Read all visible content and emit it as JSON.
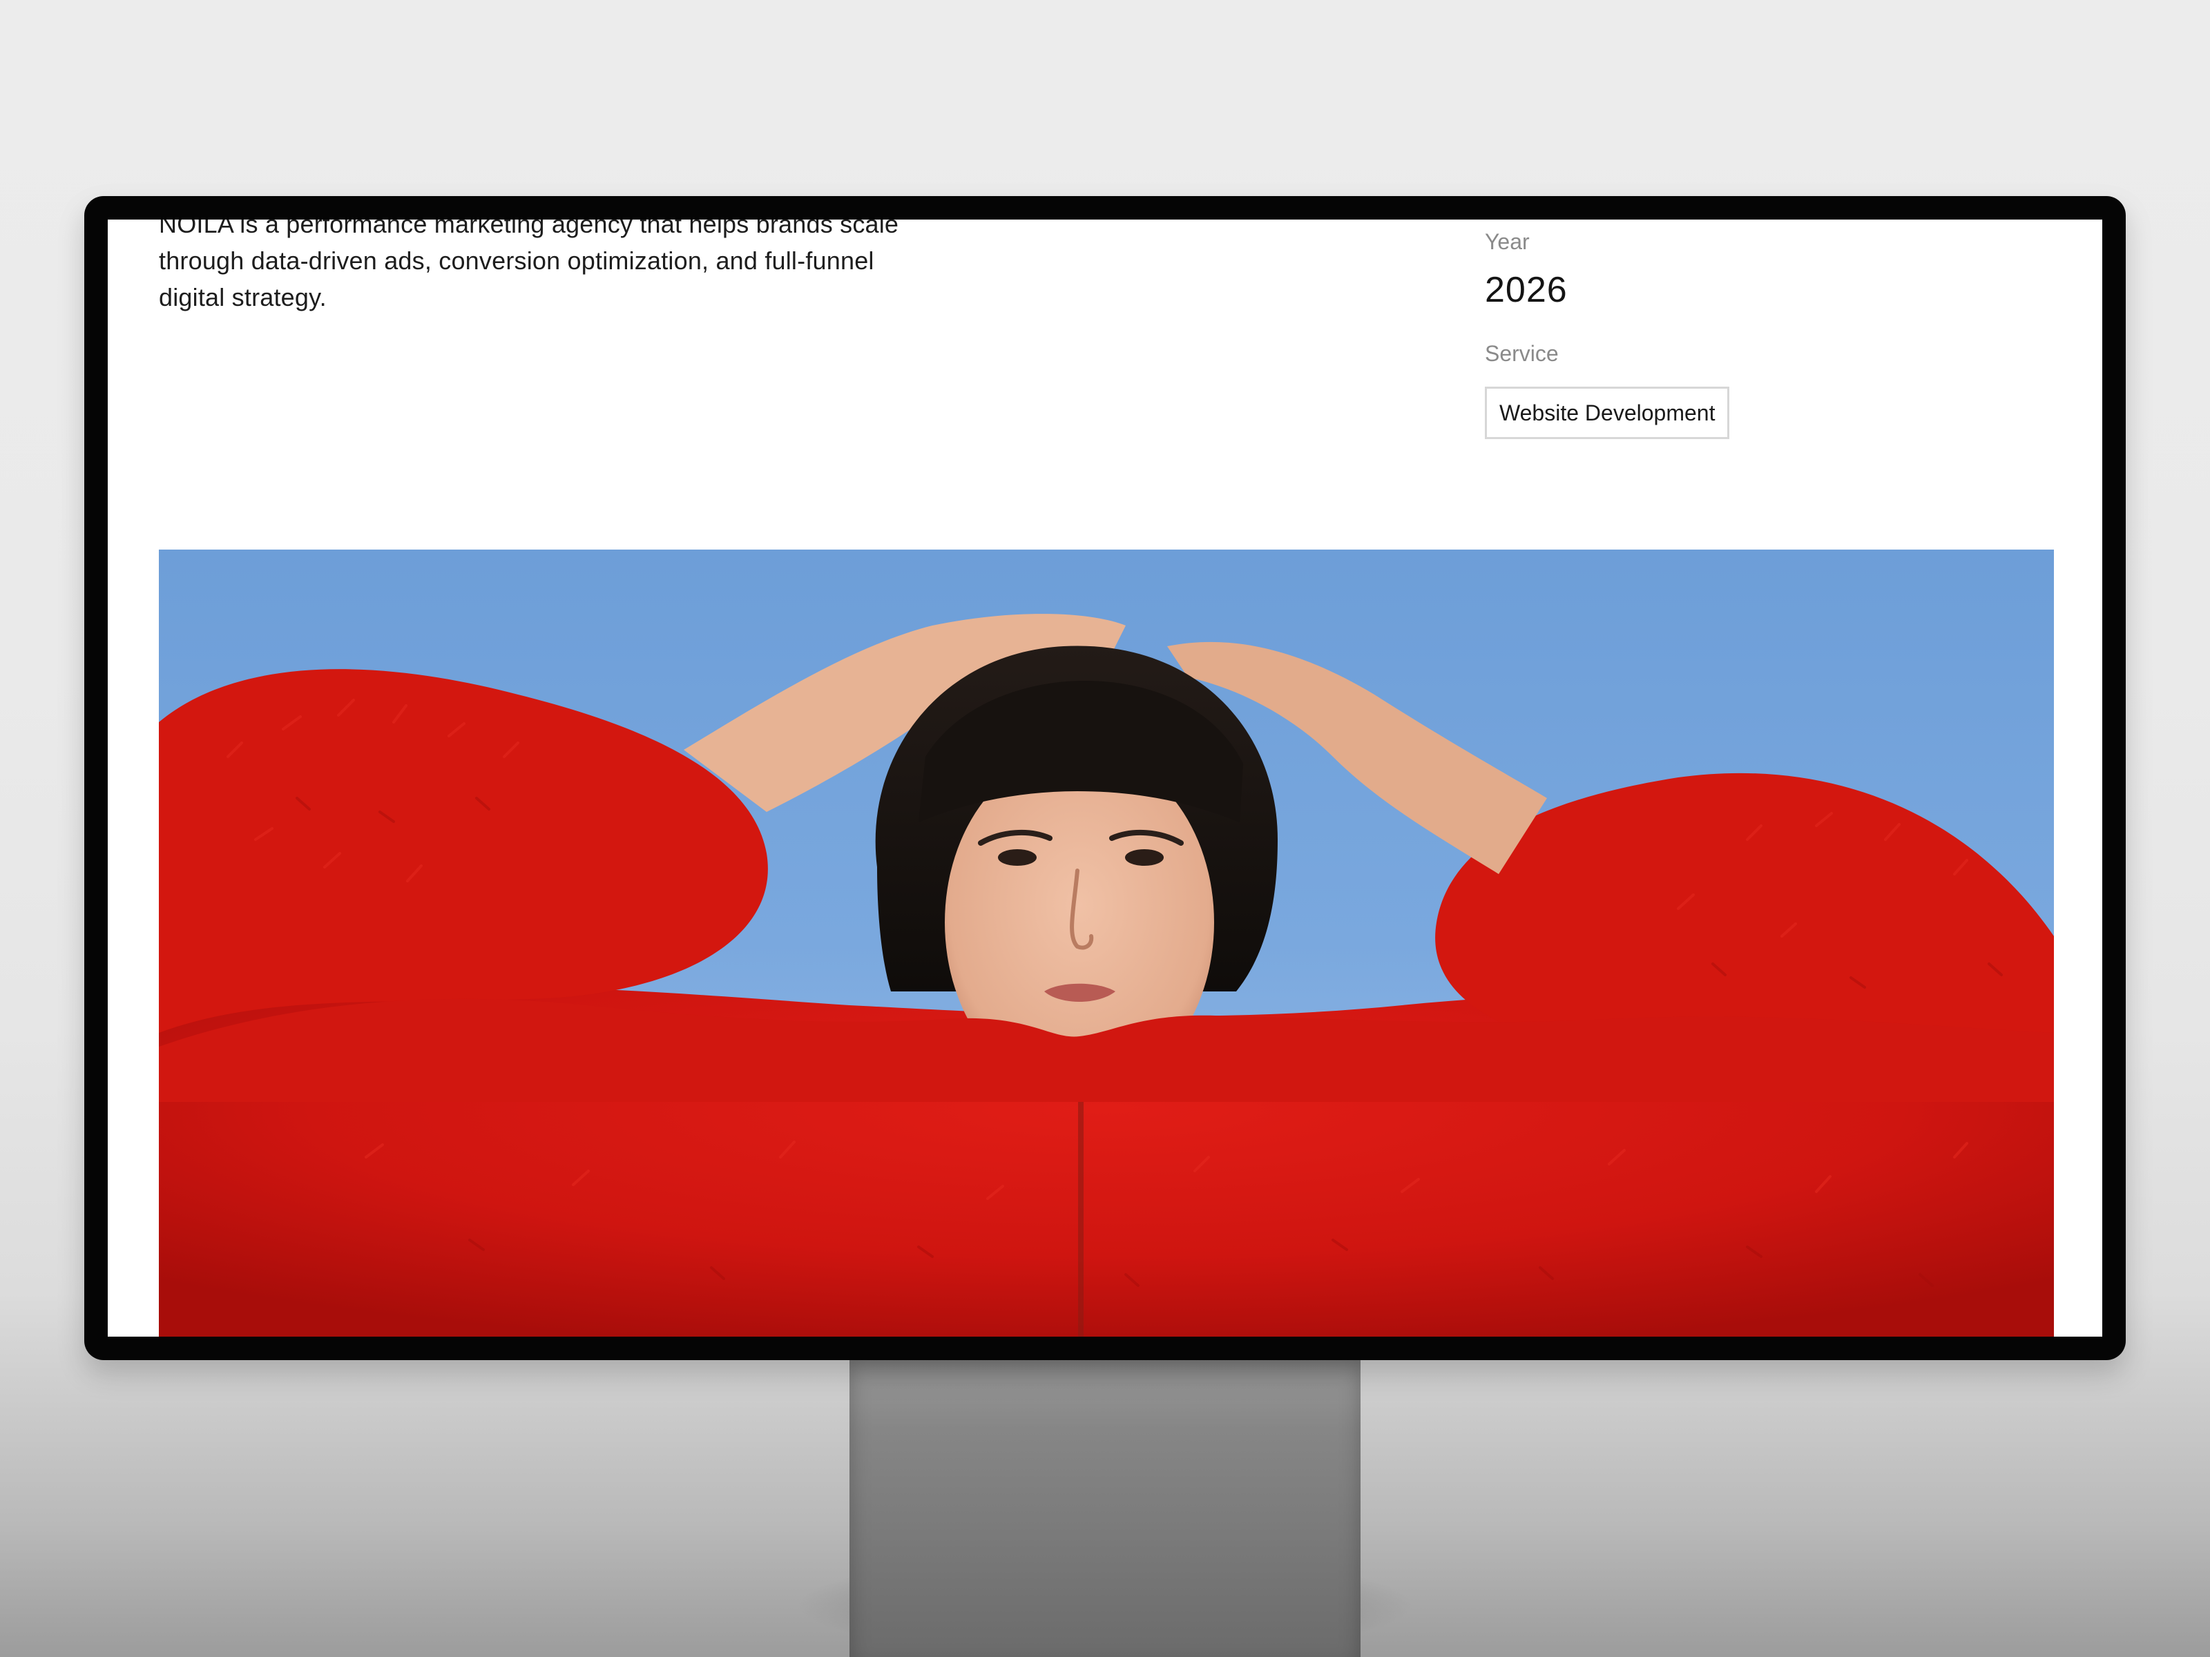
{
  "intro": {
    "text": "NOILA is a performance marketing agency that helps brands scale through data-driven ads, conversion optimization, and full-funnel digital strategy."
  },
  "meta": {
    "year_label": "Year",
    "year_value": "2026",
    "service_label": "Service",
    "service_tag": "Website Development"
  },
  "hero": {
    "icon": "portrait-photo-icon",
    "colors": {
      "sky": "#7aa8de",
      "coat": "#d41511",
      "hair": "#161210",
      "skin": "#e9b79b"
    }
  }
}
